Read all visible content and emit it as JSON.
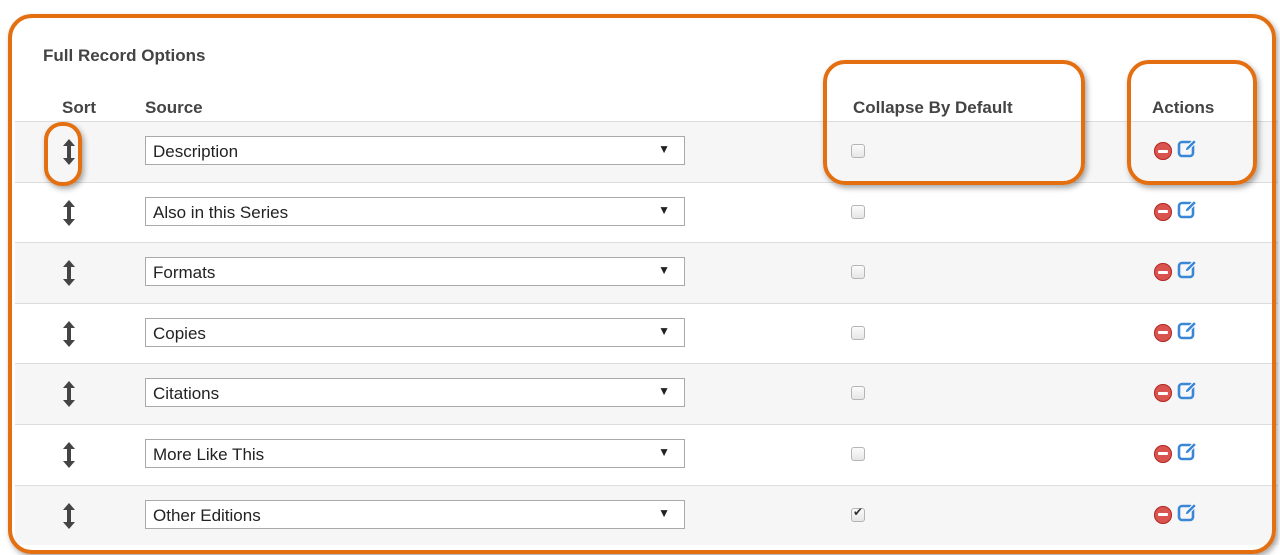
{
  "panel": {
    "title": "Full Record Options"
  },
  "table": {
    "headers": {
      "sort": "Sort",
      "source": "Source",
      "collapse": "Collapse By Default",
      "actions": "Actions"
    },
    "rows": [
      {
        "source": "Description",
        "collapse": false
      },
      {
        "source": "Also in this Series",
        "collapse": false
      },
      {
        "source": "Formats",
        "collapse": false
      },
      {
        "source": "Copies",
        "collapse": false
      },
      {
        "source": "Citations",
        "collapse": false
      },
      {
        "source": "More Like This",
        "collapse": false
      },
      {
        "source": "Other Editions",
        "collapse": true
      }
    ]
  },
  "icons": {
    "sort": "sort-arrows-icon",
    "remove": "remove-icon",
    "edit": "edit-icon",
    "dropdown": "chevron-down-icon"
  },
  "colors": {
    "highlight": "#e46f10",
    "remove": "#d9534f",
    "edit": "#3a87d6",
    "row_stripe": "#f6f6f6"
  }
}
